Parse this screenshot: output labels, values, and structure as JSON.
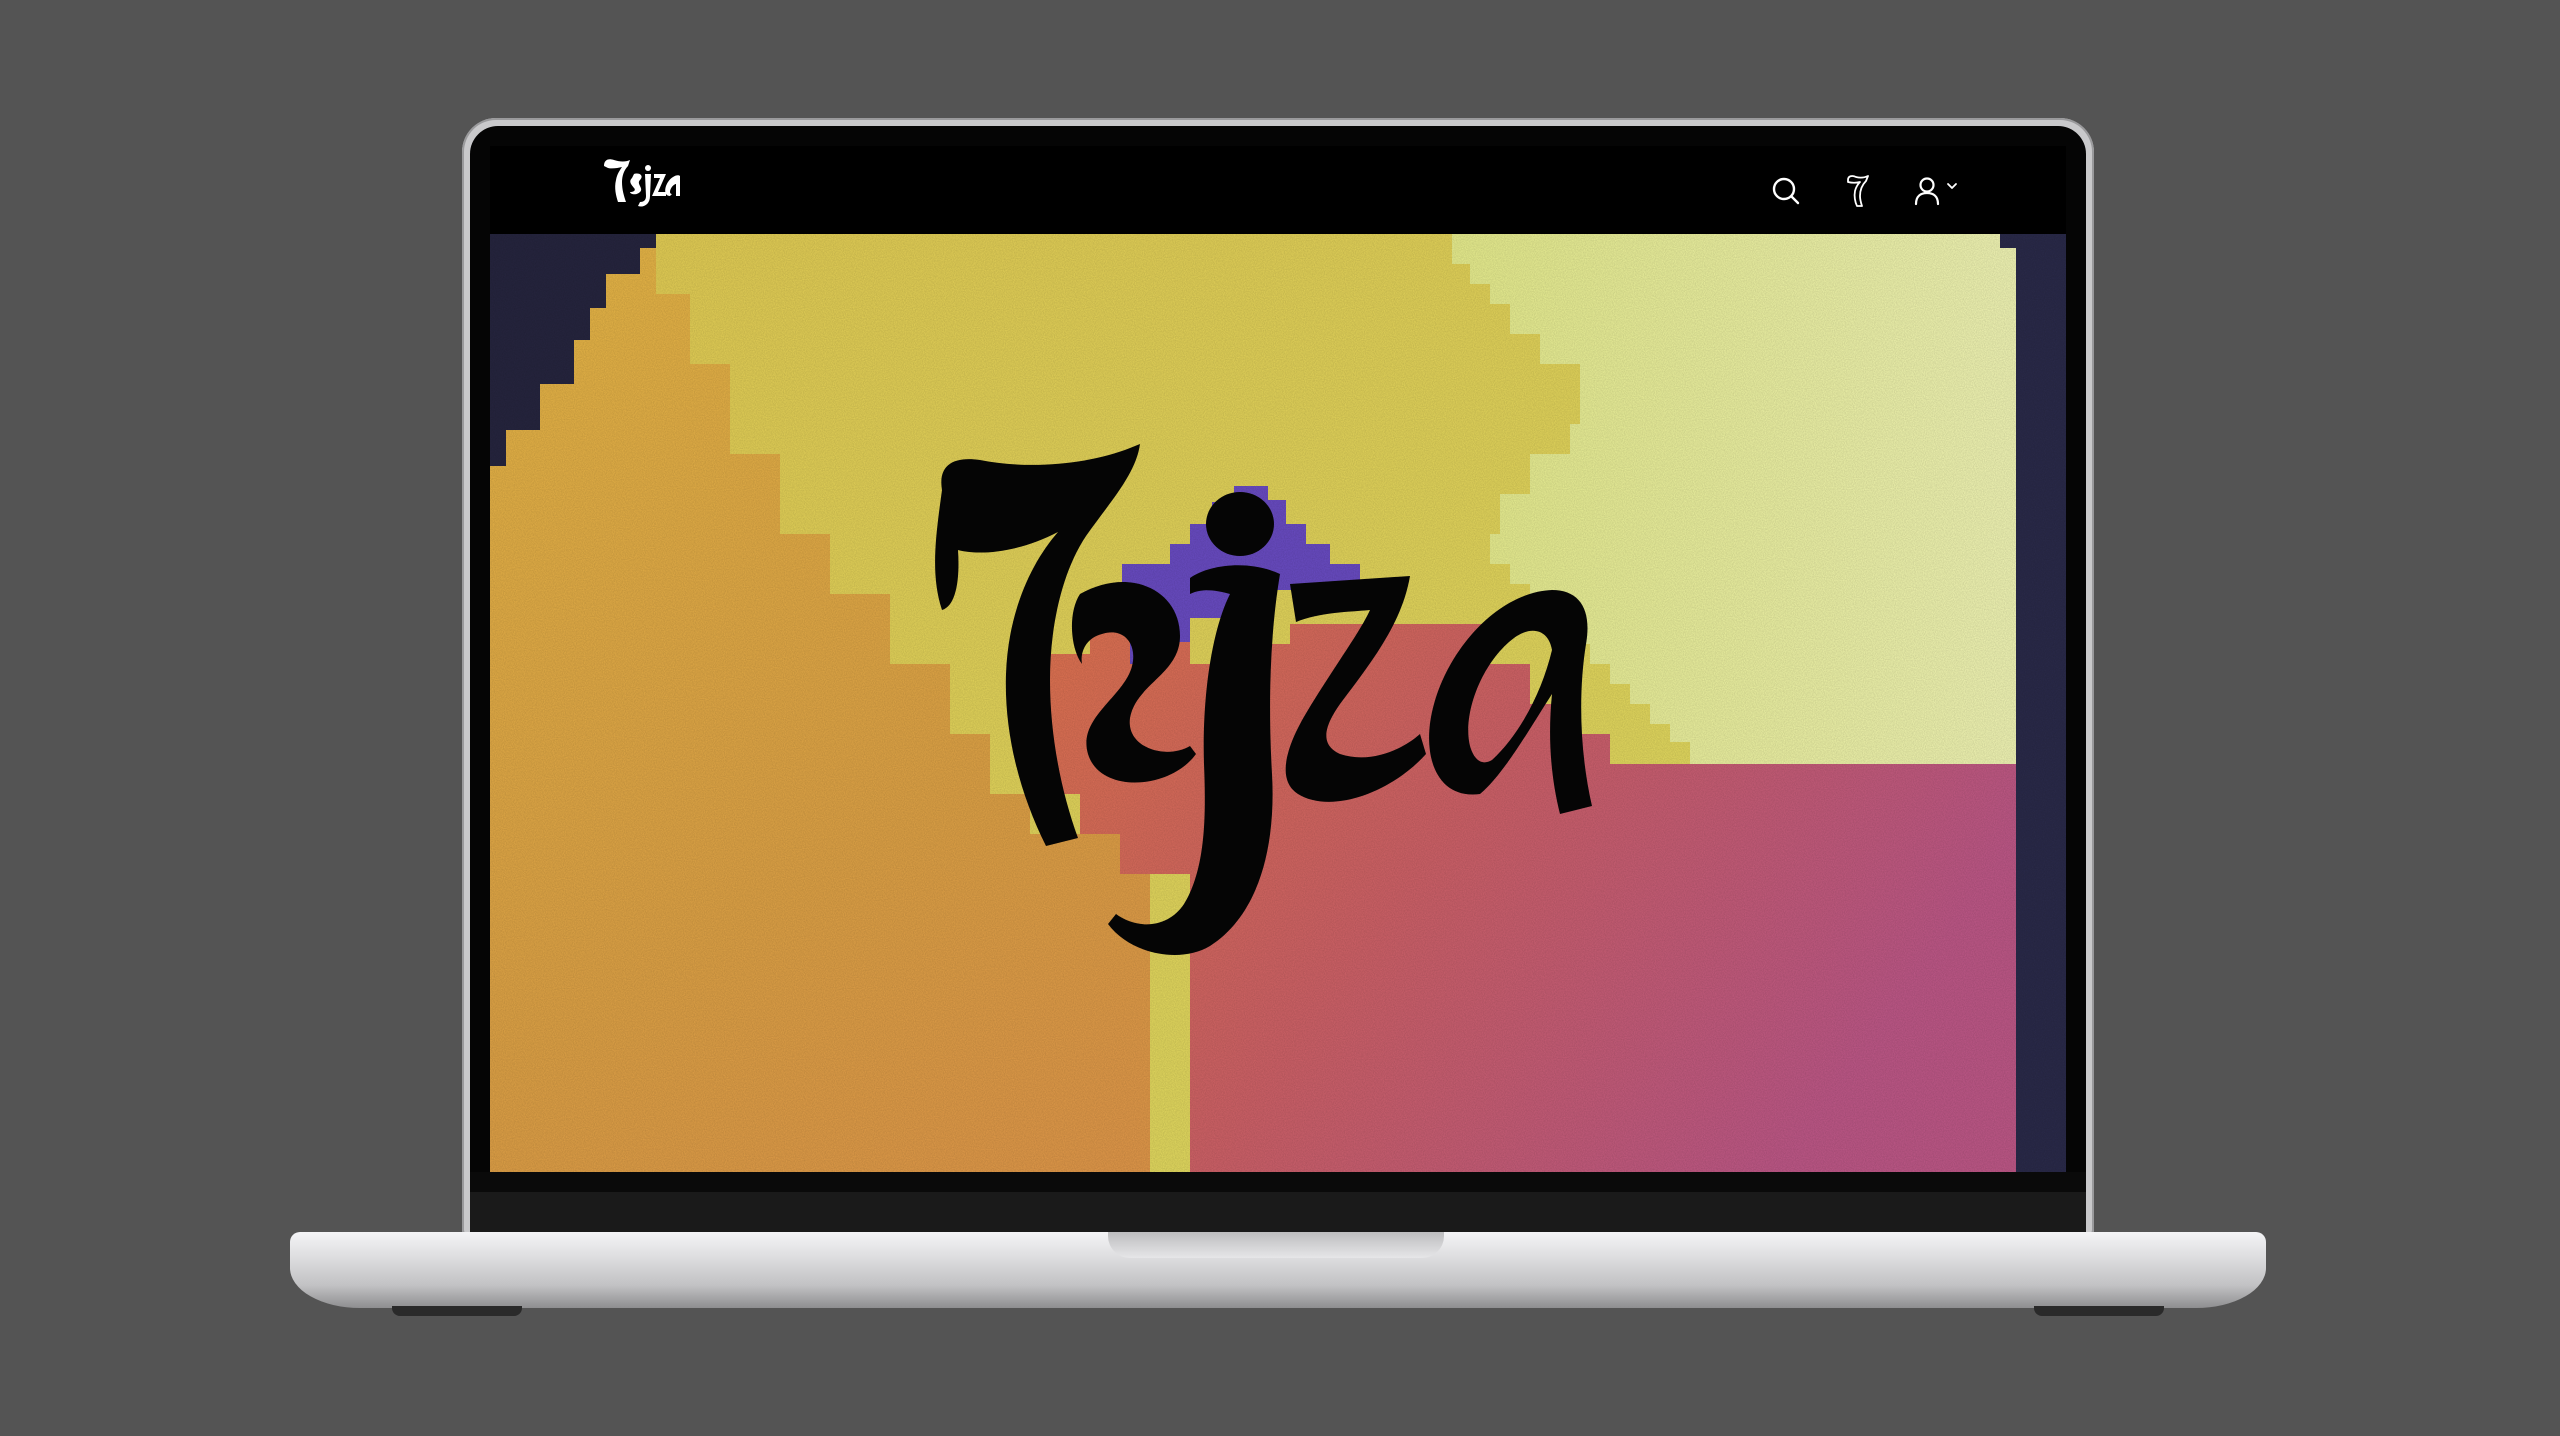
{
  "app": {
    "brand_name": "Tsjza",
    "logo_text": "Tsjza"
  },
  "header": {
    "icons": [
      "search-icon",
      "tsjza-glyph-icon",
      "user-icon",
      "chevron-down-icon"
    ]
  },
  "hero": {
    "wordmark": "Tsjza",
    "colors": {
      "navy": "#272640",
      "orange": "#e0a040",
      "yellow": "#dcdb5a",
      "pale_yellow": "#eff5b4",
      "purple": "#6b4fc2",
      "magenta": "#c45a86",
      "black": "#000000"
    }
  },
  "colors": {
    "background": "#545454",
    "laptop_silver": "#d8d8da",
    "bezel": "#050505"
  }
}
